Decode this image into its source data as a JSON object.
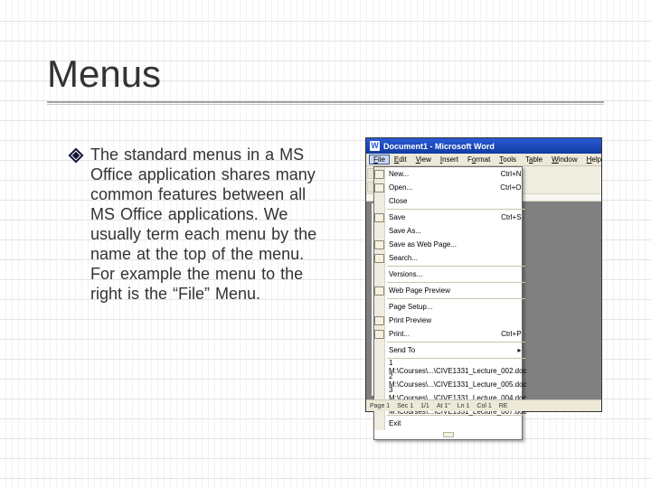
{
  "title": "Menus",
  "body_text": "The standard menus in a MS Office application shares many common features between all MS Office applications. We usually term each menu by the name at the top of the menu. For example the menu to the right is the “File” Menu.",
  "word_window": {
    "title": "Document1 - Microsoft Word",
    "menubar": [
      "File",
      "Edit",
      "View",
      "Insert",
      "Format",
      "Tools",
      "Table",
      "Window",
      "Help"
    ],
    "menubar_underlines": [
      "F",
      "E",
      "V",
      "I",
      "o",
      "T",
      "a",
      "W",
      "H"
    ],
    "selected_menu_index": 0,
    "file_menu": [
      {
        "label": "New...",
        "shortcut": "Ctrl+N",
        "icon": true
      },
      {
        "label": "Open...",
        "shortcut": "Ctrl+O",
        "icon": true
      },
      {
        "label": "Close",
        "shortcut": "",
        "icon": false
      },
      {
        "sep": true
      },
      {
        "label": "Save",
        "shortcut": "Ctrl+S",
        "icon": true
      },
      {
        "label": "Save As...",
        "shortcut": "",
        "icon": false
      },
      {
        "label": "Save as Web Page...",
        "shortcut": "",
        "icon": true
      },
      {
        "label": "Search...",
        "shortcut": "",
        "icon": true
      },
      {
        "sep": true
      },
      {
        "label": "Versions...",
        "shortcut": "",
        "icon": false
      },
      {
        "sep": true
      },
      {
        "label": "Web Page Preview",
        "shortcut": "",
        "icon": true
      },
      {
        "sep": true
      },
      {
        "label": "Page Setup...",
        "shortcut": "",
        "icon": false
      },
      {
        "label": "Print Preview",
        "shortcut": "",
        "icon": true
      },
      {
        "label": "Print...",
        "shortcut": "Ctrl+P",
        "icon": true
      },
      {
        "sep": true
      },
      {
        "label": "Send To",
        "shortcut": "",
        "icon": false,
        "submenu": true
      },
      {
        "sep": true
      },
      {
        "label": "1 M:\\Courses\\...\\CIVE1331_Lecture_002.doc",
        "shortcut": "",
        "icon": false
      },
      {
        "label": "2 M:\\Courses\\...\\CIVE1331_Lecture_005.doc",
        "shortcut": "",
        "icon": false
      },
      {
        "label": "3 M:\\Courses\\...\\CIVE1331_Lecture_004.doc",
        "shortcut": "",
        "icon": false
      },
      {
        "label": "4 M:\\Courses\\...\\CIVE1331_Lecture_007.doc",
        "shortcut": "",
        "icon": false
      },
      {
        "sep": true
      },
      {
        "label": "Exit",
        "shortcut": "",
        "icon": false
      }
    ],
    "statusbar": [
      "Page 1",
      "Sec 1",
      "1/1",
      "At 1\"",
      "Ln 1",
      "Col 1",
      "RE"
    ]
  }
}
